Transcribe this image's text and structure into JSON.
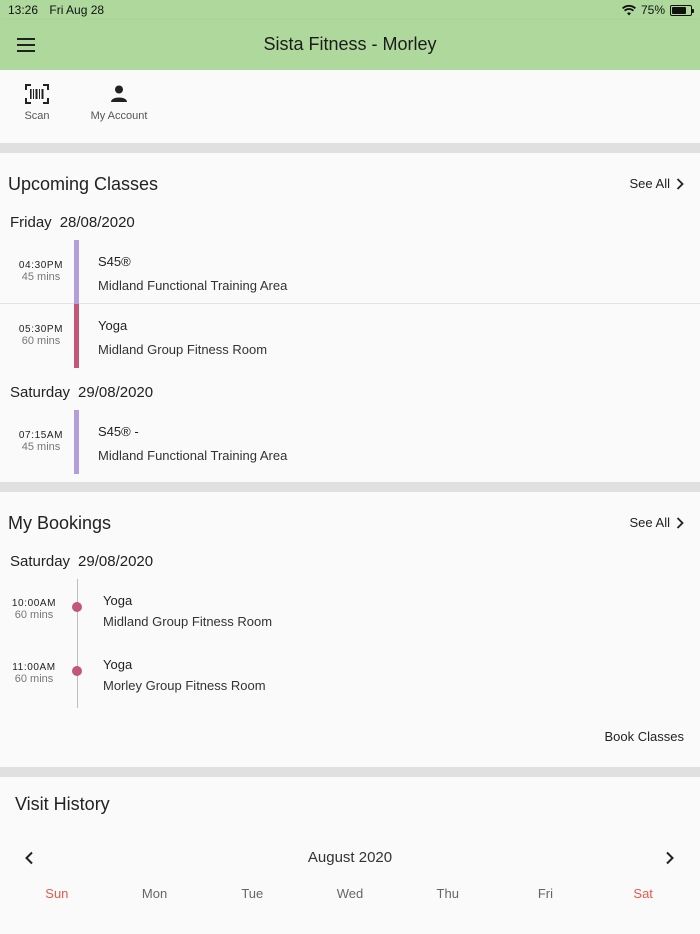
{
  "status_bar": {
    "time": "13:26",
    "date": "Fri Aug 28",
    "battery": "75%",
    "battery_level": 0.75
  },
  "app_bar": {
    "title": "Sista Fitness - Morley",
    "menu_icon": "hamburger-menu-icon"
  },
  "quick_actions": [
    {
      "label": "Scan",
      "icon": "barcode-scan-icon"
    },
    {
      "label": "My Account",
      "icon": "person-icon"
    }
  ],
  "upcoming": {
    "title": "Upcoming Classes",
    "see_all": "See All",
    "groups": [
      {
        "day": "Friday",
        "date": "28/08/2020",
        "classes": [
          {
            "time": "04:30PM",
            "duration": "45 mins",
            "name": "S45®",
            "location": "Midland Functional Training Area",
            "color": "#b39ddb"
          },
          {
            "time": "05:30PM",
            "duration": "60 mins",
            "name": "Yoga",
            "location": "Midland Group Fitness Room",
            "color": "#c2577a"
          }
        ]
      },
      {
        "day": "Saturday",
        "date": "29/08/2020",
        "classes": [
          {
            "time": "07:15AM",
            "duration": "45 mins",
            "name": "S45® -",
            "location": "Midland Functional Training Area",
            "color": "#b39ddb"
          }
        ]
      }
    ]
  },
  "bookings": {
    "title": "My Bookings",
    "see_all": "See All",
    "day": "Saturday",
    "date": "29/08/2020",
    "items": [
      {
        "time": "10:00AM",
        "duration": "60 mins",
        "name": "Yoga",
        "location": "Midland Group Fitness Room"
      },
      {
        "time": "11:00AM",
        "duration": "60 mins",
        "name": "Yoga",
        "location": "Morley Group Fitness Room"
      }
    ],
    "book_classes": "Book Classes"
  },
  "visit_history": {
    "title": "Visit History",
    "month": "August 2020",
    "weekdays": [
      "Sun",
      "Mon",
      "Tue",
      "Wed",
      "Thu",
      "Fri",
      "Sat"
    ]
  },
  "colors": {
    "app_bar": "#afd99c",
    "weekend": "#e25b4a",
    "booking_dot": "#c2577a"
  }
}
